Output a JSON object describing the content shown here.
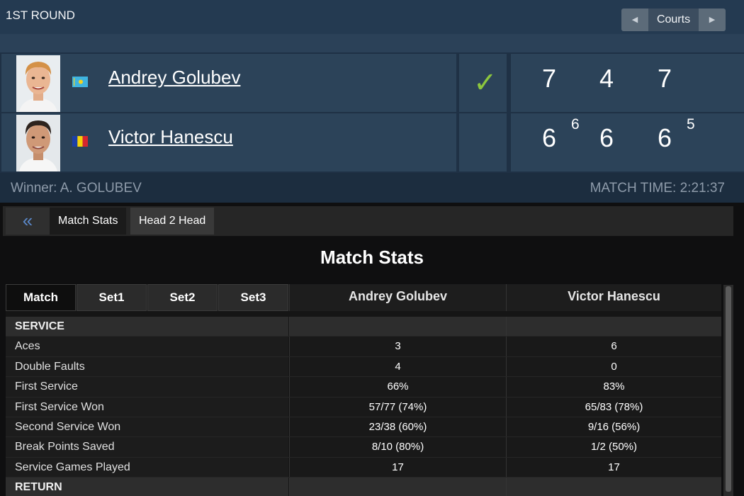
{
  "header": {
    "round": "1ST ROUND",
    "courts_label": "Courts",
    "prev_icon": "◀",
    "next_icon": "▶"
  },
  "players": [
    {
      "name": "Andrey Golubev",
      "flag": "kazakhstan-flag",
      "winner_mark": "✓",
      "sets": [
        "7",
        "4",
        "7"
      ],
      "tiebreaks": [
        "",
        "",
        ""
      ]
    },
    {
      "name": "Victor Hanescu",
      "flag": "romania-flag",
      "winner_mark": "",
      "sets": [
        "6",
        "6",
        "6"
      ],
      "tiebreaks": [
        "6",
        "",
        "5"
      ]
    }
  ],
  "result": {
    "winner": "Winner: A. GOLUBEV",
    "match_time": "MATCH TIME: 2:21:37"
  },
  "tabs": {
    "back_icon": "«",
    "match_stats": "Match Stats",
    "head2head": "Head 2 Head"
  },
  "stats": {
    "title": "Match Stats",
    "period_tabs": [
      "Match",
      "Set1",
      "Set2",
      "Set3"
    ],
    "active_period": "Match",
    "player1": "Andrey Golubev",
    "player2": "Victor Hanescu",
    "rows": [
      {
        "label": "SERVICE",
        "p1": "",
        "p2": "",
        "section": true
      },
      {
        "label": "Aces",
        "p1": "3",
        "p2": "6"
      },
      {
        "label": "Double Faults",
        "p1": "4",
        "p2": "0"
      },
      {
        "label": "First Service",
        "p1": "66%",
        "p2": "83%"
      },
      {
        "label": "First Service Won",
        "p1": "57/77 (74%)",
        "p2": "65/83 (78%)"
      },
      {
        "label": "Second Service Won",
        "p1": "23/38 (60%)",
        "p2": "9/16 (56%)"
      },
      {
        "label": "Break Points Saved",
        "p1": "8/10 (80%)",
        "p2": "1/2 (50%)"
      },
      {
        "label": "Service Games Played",
        "p1": "17",
        "p2": "17"
      },
      {
        "label": "RETURN",
        "p1": "",
        "p2": "",
        "section": true
      }
    ]
  },
  "colors": {
    "scoreboard_bg": "#1f3145",
    "cell_bg": "#2c4359",
    "check_green": "#8cc63e",
    "muted_text": "#8e9baa",
    "back_arrow_blue": "#5b88c9"
  }
}
